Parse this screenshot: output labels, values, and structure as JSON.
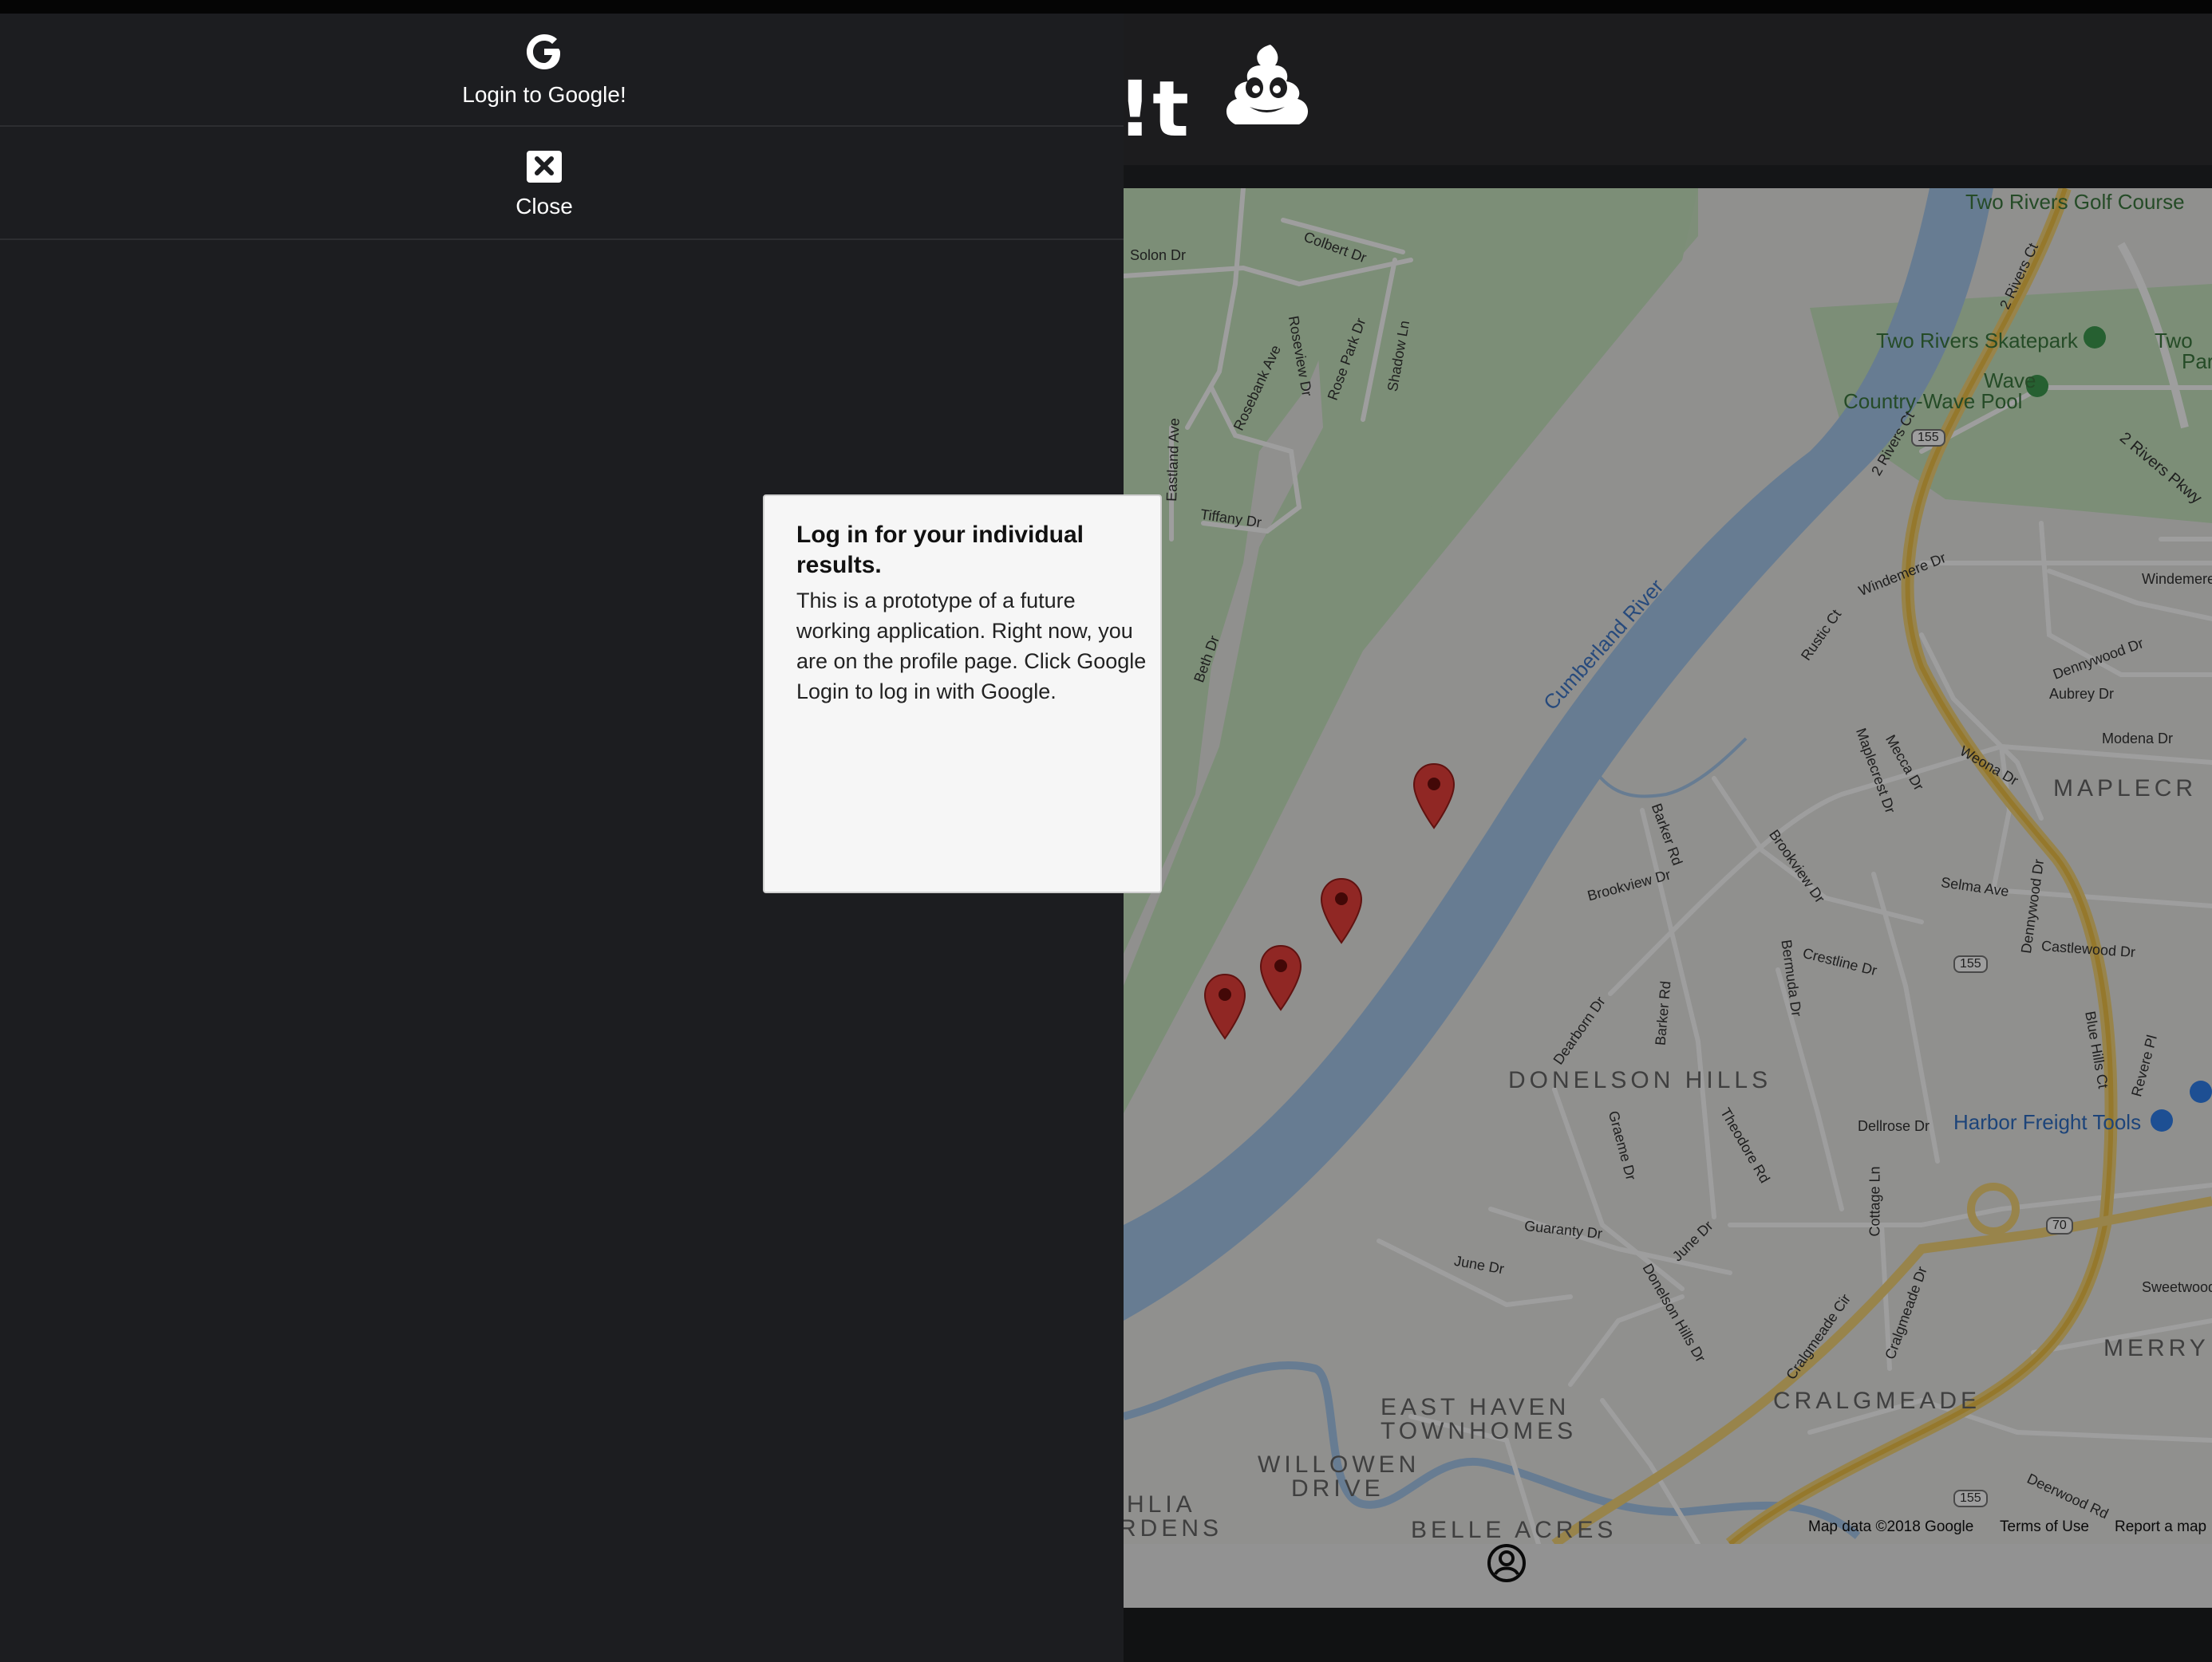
{
  "header": {
    "title_fragment": "t!",
    "logo_icon": "poop-emoji-icon"
  },
  "menu": {
    "login": {
      "label": "Login to Google!",
      "icon": "google-g-icon"
    },
    "close": {
      "label": "Close",
      "icon": "close-box-icon"
    }
  },
  "modal": {
    "title": "Log in for your individual results.",
    "body": "This is a prototype of a future working application. Right now, you are on the profile page. Click Google Login to log in with Google."
  },
  "map": {
    "attribution": {
      "data": "Map data ©2018 Google",
      "terms": "Terms of Use",
      "report": "Report a map"
    },
    "places": {
      "golf": "Two Rivers Golf Course",
      "skatepark": "Two Rivers Skatepark",
      "wave": "Wave",
      "country_wave": "Country-Wave Pool",
      "two_rivers": "Two",
      "two_rivers_2": "Par",
      "harbor_freight": "Harbor Freight Tools",
      "river": "Cumberland River",
      "donelson_hills": "DONELSON HILLS",
      "maplecrest": "MAPLECR",
      "merry": "MERRY",
      "cralgmeade": "CRALGMEADE",
      "east_haven_1": "EAST HAVEN",
      "east_haven_2": "TOWNHOMES",
      "willowen_1": "WILLOWEN",
      "willowen_2": "DRIVE",
      "belle_acres": "BELLE ACRES",
      "hlia": "HLIA",
      "rdens": "RDENS"
    },
    "streets": {
      "solon": "Solon Dr",
      "colbert": "Colbert Dr",
      "shadow": "Shadow Ln",
      "rosebank": "Rosebank Ave",
      "roseview": "Roseview Dr",
      "rosepark": "Rose Park Dr",
      "eastland": "Eastland Ave",
      "tiffany": "Tiffany Dr",
      "beth": "Beth Dr",
      "windemere": "Windemere Dr",
      "windemere2": "Windemere",
      "rustic": "Rustic Ct",
      "dennywood": "Dennywood Dr",
      "aubrey": "Aubrey Dr",
      "modena": "Modena Dr",
      "weona": "Weona Dr",
      "mecca": "Mecca Dr",
      "maplecrest_dr": "Maplecrest Dr",
      "barker": "Barker Rd",
      "brookview": "Brookview Dr",
      "brookview2": "Brookview Dr",
      "selma": "Selma Ave",
      "dennywood2": "Dennywood Dr",
      "castlewood": "Castlewood Dr",
      "crestline": "Crestline Dr",
      "bermuda": "Bermuda Dr",
      "dearborn": "Dearborn Dr",
      "barker2": "Barker Rd",
      "graeme": "Graeme Dr",
      "theodore": "Theodore Rd",
      "dellrose": "Dellrose Dr",
      "guaranty": "Guaranty Dr",
      "june": "June Dr",
      "june2": "June Dr",
      "donelson_hills_dr": "Donelson Hills Dr",
      "cottage": "Cottage Ln",
      "cralgmeade_cir": "Cralgmeade Cir",
      "cralgmeade_dr": "Cralgmeade Dr",
      "sweetwood": "Sweetwood",
      "deerwood": "Deerwood Rd",
      "blue_hills": "Blue Hills Ct",
      "revere": "Revere Pl",
      "two_rivers_ct": "2 Rivers Ct",
      "two_rivers_ct2": "2 Rivers Ct",
      "two_rivers_pkwy": "2 Rivers Pkwy"
    },
    "shields": {
      "us155a": "155",
      "us155b": "155",
      "us155c": "155",
      "us155d": "155",
      "us70": "70"
    }
  }
}
